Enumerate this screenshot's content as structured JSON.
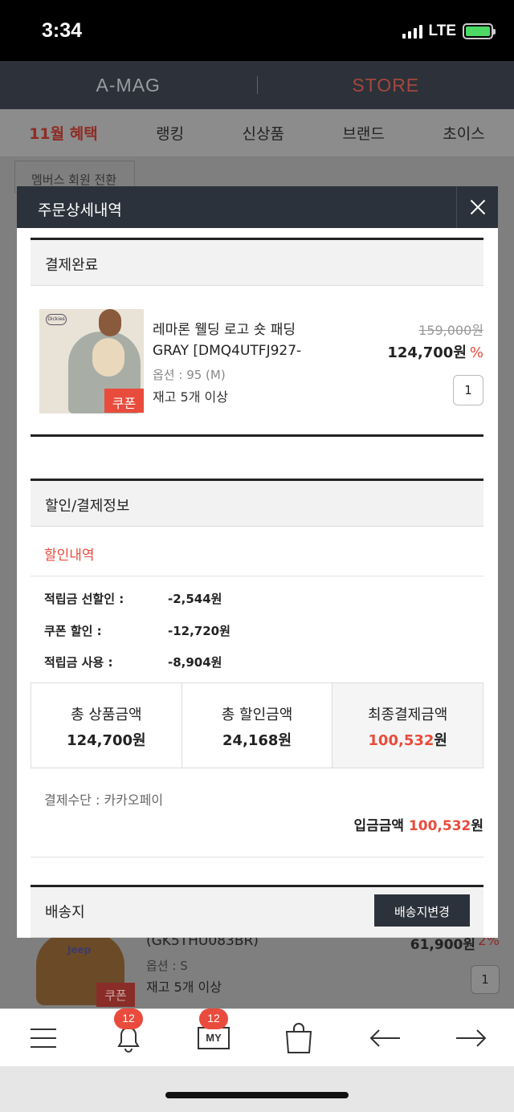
{
  "status_bar": {
    "time": "3:34",
    "network": "LTE"
  },
  "top_tabs": [
    {
      "label": "A-MAG",
      "active": false
    },
    {
      "label": "STORE",
      "active": true
    }
  ],
  "category_tabs": [
    {
      "label": "11월 혜택",
      "active": true
    },
    {
      "label": "랭킹",
      "active": false
    },
    {
      "label": "신상품",
      "active": false
    },
    {
      "label": "브랜드",
      "active": false
    },
    {
      "label": "초이스",
      "active": false
    }
  ],
  "background": {
    "member_button": "멤버스 회원 전환",
    "product": {
      "code": "(GK5THU083BR)",
      "option": "옵션 : S",
      "stock": "재고 5개 이상",
      "price": "61,900원",
      "discount": "2%",
      "quantity": "1",
      "coupon": "쿠폰"
    }
  },
  "modal": {
    "title": "주문상세내역",
    "status_section": "결제완료",
    "product": {
      "name_line1": "레마론 웰딩 로고 숏 패딩",
      "name_line2": "GRAY [DMQ4UTFJ927-",
      "option": "옵션 : 95 (M)",
      "stock": "재고 5개 이상",
      "original_price": "159,000원",
      "sale_price": "124,700원",
      "percent_sign": "%",
      "quantity": "1",
      "coupon_badge": "쿠폰"
    },
    "payment_section": "할인/결제정보",
    "discount_header": "할인내역",
    "discounts": [
      {
        "label": "적립금 선할인 :",
        "value": "-2,544원"
      },
      {
        "label": "쿠폰 할인 :",
        "value": "-12,720원"
      },
      {
        "label": "적립금 사용 :",
        "value": "-8,904원"
      }
    ],
    "summary": {
      "total_product_label": "총 상품금액",
      "total_product_value": "124,700원",
      "total_discount_label": "총 할인금액",
      "total_discount_value": "24,168원",
      "final_label": "최종결제금액",
      "final_value_number": "100,532",
      "final_value_unit": "원"
    },
    "payment_method": "결제수단 : 카카오페이",
    "deposit_label": "입금금액",
    "deposit_number": "100,532",
    "deposit_unit": "원",
    "shipping_section": "배송지",
    "shipping_change_button": "배송지변경"
  },
  "toolbar": {
    "notification_badge": "12",
    "my_badge": "12",
    "my_label": "MY"
  },
  "colors": {
    "accent": "#e94b3c",
    "header_dark": "#2c323b"
  }
}
